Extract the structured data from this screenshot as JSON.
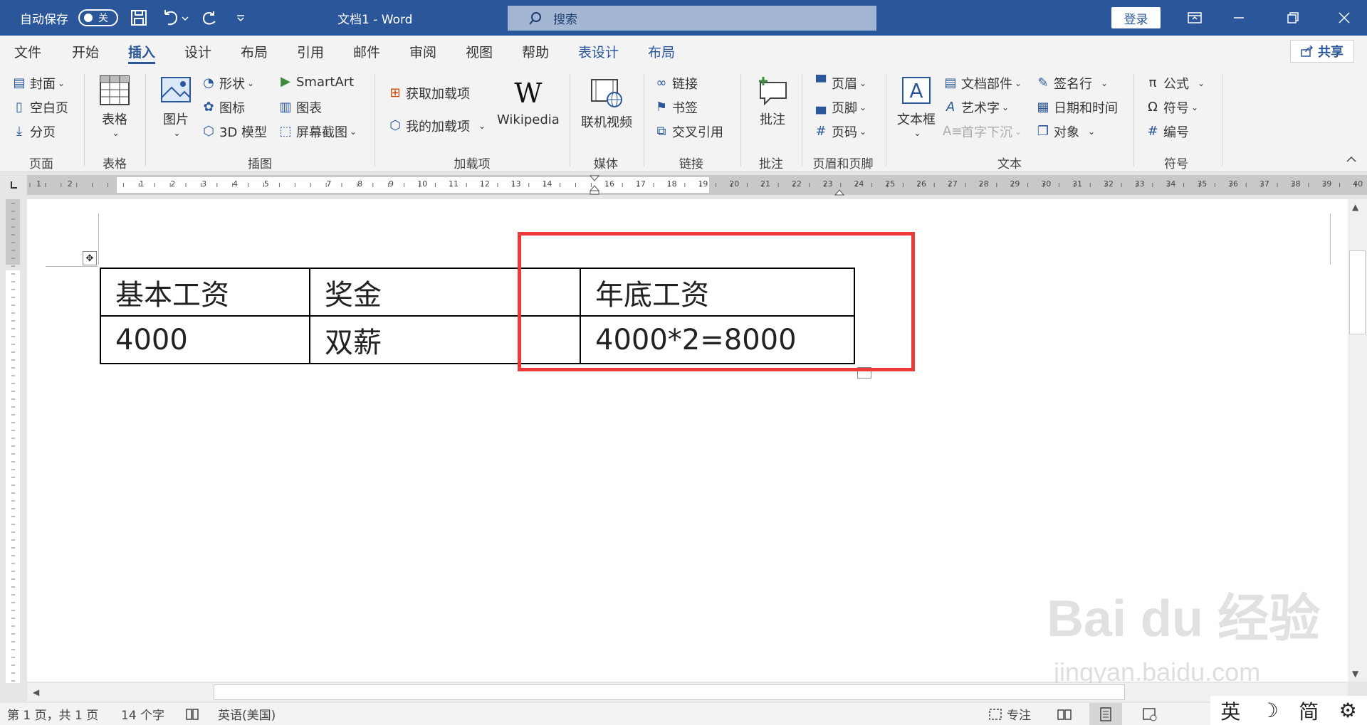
{
  "titlebar": {
    "autosave_label": "自动保存",
    "autosave_state": "关",
    "doc_title": "文档1  -  Word",
    "search_placeholder": "搜索",
    "login": "登录"
  },
  "tabs": [
    {
      "label": "文件"
    },
    {
      "label": "开始"
    },
    {
      "label": "插入"
    },
    {
      "label": "设计"
    },
    {
      "label": "布局"
    },
    {
      "label": "引用"
    },
    {
      "label": "邮件"
    },
    {
      "label": "审阅"
    },
    {
      "label": "视图"
    },
    {
      "label": "帮助"
    },
    {
      "label": "表设计"
    },
    {
      "label": "布局"
    }
  ],
  "active_tab": "插入",
  "share": "共享",
  "ribbon": {
    "pages": {
      "cover": "封面",
      "blank": "空白页",
      "break": "分页",
      "group": "页面"
    },
    "tables": {
      "table": "表格",
      "group": "表格"
    },
    "illus": {
      "picture": "图片",
      "shapes": "形状",
      "icons": "图标",
      "model3d": "3D 模型",
      "smartart": "SmartArt",
      "chart": "图表",
      "screenshot": "屏幕截图",
      "group": "插图"
    },
    "addins": {
      "get": "获取加载项",
      "mine": "我的加载项",
      "wiki": "Wikipedia",
      "group": "加载项"
    },
    "media": {
      "video": "联机视频",
      "group": "媒体"
    },
    "links": {
      "link": "链接",
      "bookmark": "书签",
      "xref": "交叉引用",
      "group": "链接"
    },
    "comments": {
      "comment": "批注",
      "group": "批注"
    },
    "hf": {
      "header": "页眉",
      "footer": "页脚",
      "pagenum": "页码",
      "group": "页眉和页脚"
    },
    "text": {
      "textbox": "文本框",
      "parts": "文档部件",
      "wordart": "艺术字",
      "dropcap": "首字下沉",
      "sigline": "签名行",
      "datetime": "日期和时间",
      "object": "对象",
      "group": "文本"
    },
    "symbols": {
      "equation": "公式",
      "symbol": "符号",
      "number": "编号",
      "group": "符号"
    }
  },
  "ruler_left_numbers": [
    "2",
    "1"
  ],
  "ruler_numbers": [
    "1",
    "2",
    "3",
    "4",
    "5",
    "7",
    "8",
    "9",
    "10",
    "11",
    "12",
    "13",
    "14",
    "16",
    "17",
    "18",
    "19",
    "20",
    "21",
    "22",
    "23",
    "24",
    "25",
    "26",
    "27",
    "28",
    "29",
    "30",
    "31",
    "32",
    "33",
    "34",
    "35",
    "36",
    "37",
    "38",
    "39",
    "40"
  ],
  "table": {
    "rows": [
      [
        "基本工资",
        "奖金",
        "",
        "年底工资"
      ],
      [
        "4000",
        "双薪",
        "",
        "4000*2=8000"
      ]
    ]
  },
  "highlight_color": "#ea3a3a",
  "status": {
    "page": "第 1 页，共 1 页",
    "words": "14 个字",
    "lang": "英语(美国)",
    "focus": "专注"
  },
  "ime": {
    "lang": "英",
    "mode": "简"
  },
  "watermark": {
    "brand": "Bai du 经验",
    "url": "jingyan.baidu.com"
  }
}
